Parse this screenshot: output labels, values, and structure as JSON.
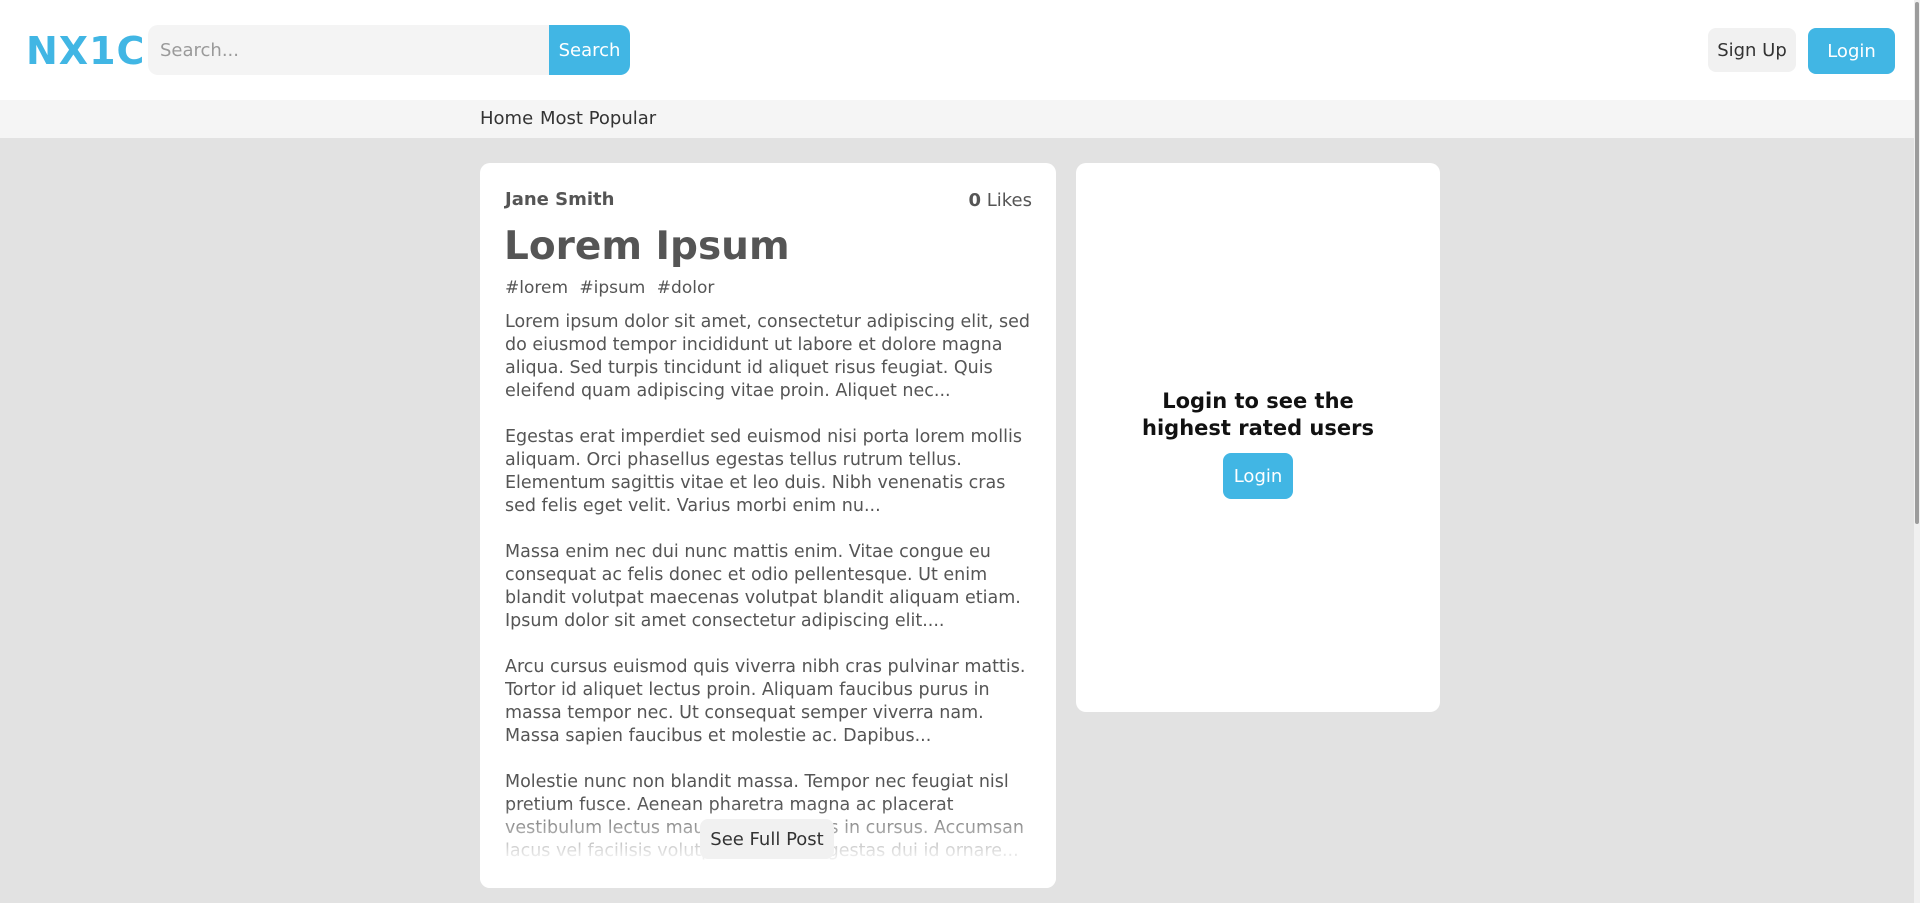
{
  "header": {
    "logo": "NX1C",
    "search_placeholder": "Search...",
    "search_button": "Search",
    "signup_button": "Sign Up",
    "login_button": "Login"
  },
  "nav": {
    "items": [
      "Home",
      "Most Popular"
    ]
  },
  "post": {
    "author": "Jane Smith",
    "likes_count": "0",
    "likes_label": "Likes",
    "title": "Lorem Ipsum",
    "tags": [
      "#lorem",
      "#ipsum",
      "#dolor"
    ],
    "paragraphs": [
      "Lorem ipsum dolor sit amet, consectetur adipiscing elit, sed do eiusmod tempor incididunt ut labore et dolore magna aliqua. Sed turpis tincidunt id aliquet risus feugiat. Quis eleifend quam adipiscing vitae proin. Aliquet nec...",
      "Egestas erat imperdiet sed euismod nisi porta lorem mollis aliquam. Orci phasellus egestas tellus rutrum tellus. Elementum sagittis vitae et leo duis. Nibh venenatis cras sed felis eget velit. Varius morbi enim nu...",
      "Massa enim nec dui nunc mattis enim. Vitae congue eu consequat ac felis donec et odio pellentesque. Ut enim blandit volutpat maecenas volutpat blandit aliquam etiam. Ipsum dolor sit amet consectetur adipiscing elit....",
      "Arcu cursus euismod quis viverra nibh cras pulvinar mattis. Tortor id aliquet lectus proin. Aliquam faucibus purus in massa tempor nec. Ut consequat semper viverra nam. Massa sapien faucibus et molestie ac. Dapibus...",
      "Molestie nunc non blandit massa. Tempor nec feugiat nisl pretium fusce. Aenean pharetra magna ac placerat vestibulum lectus mauris ultrices eros in cursus. Accumsan lacus vel facilisis volutpat est. Velit egestas dui id ornare..."
    ],
    "see_full_button": "See Full Post"
  },
  "sidebar": {
    "message_line1": "Login to see the",
    "message_line2": "highest rated users",
    "login_button": "Login"
  },
  "colors": {
    "accent": "#41b6e4",
    "background": "#e2e2e2"
  }
}
